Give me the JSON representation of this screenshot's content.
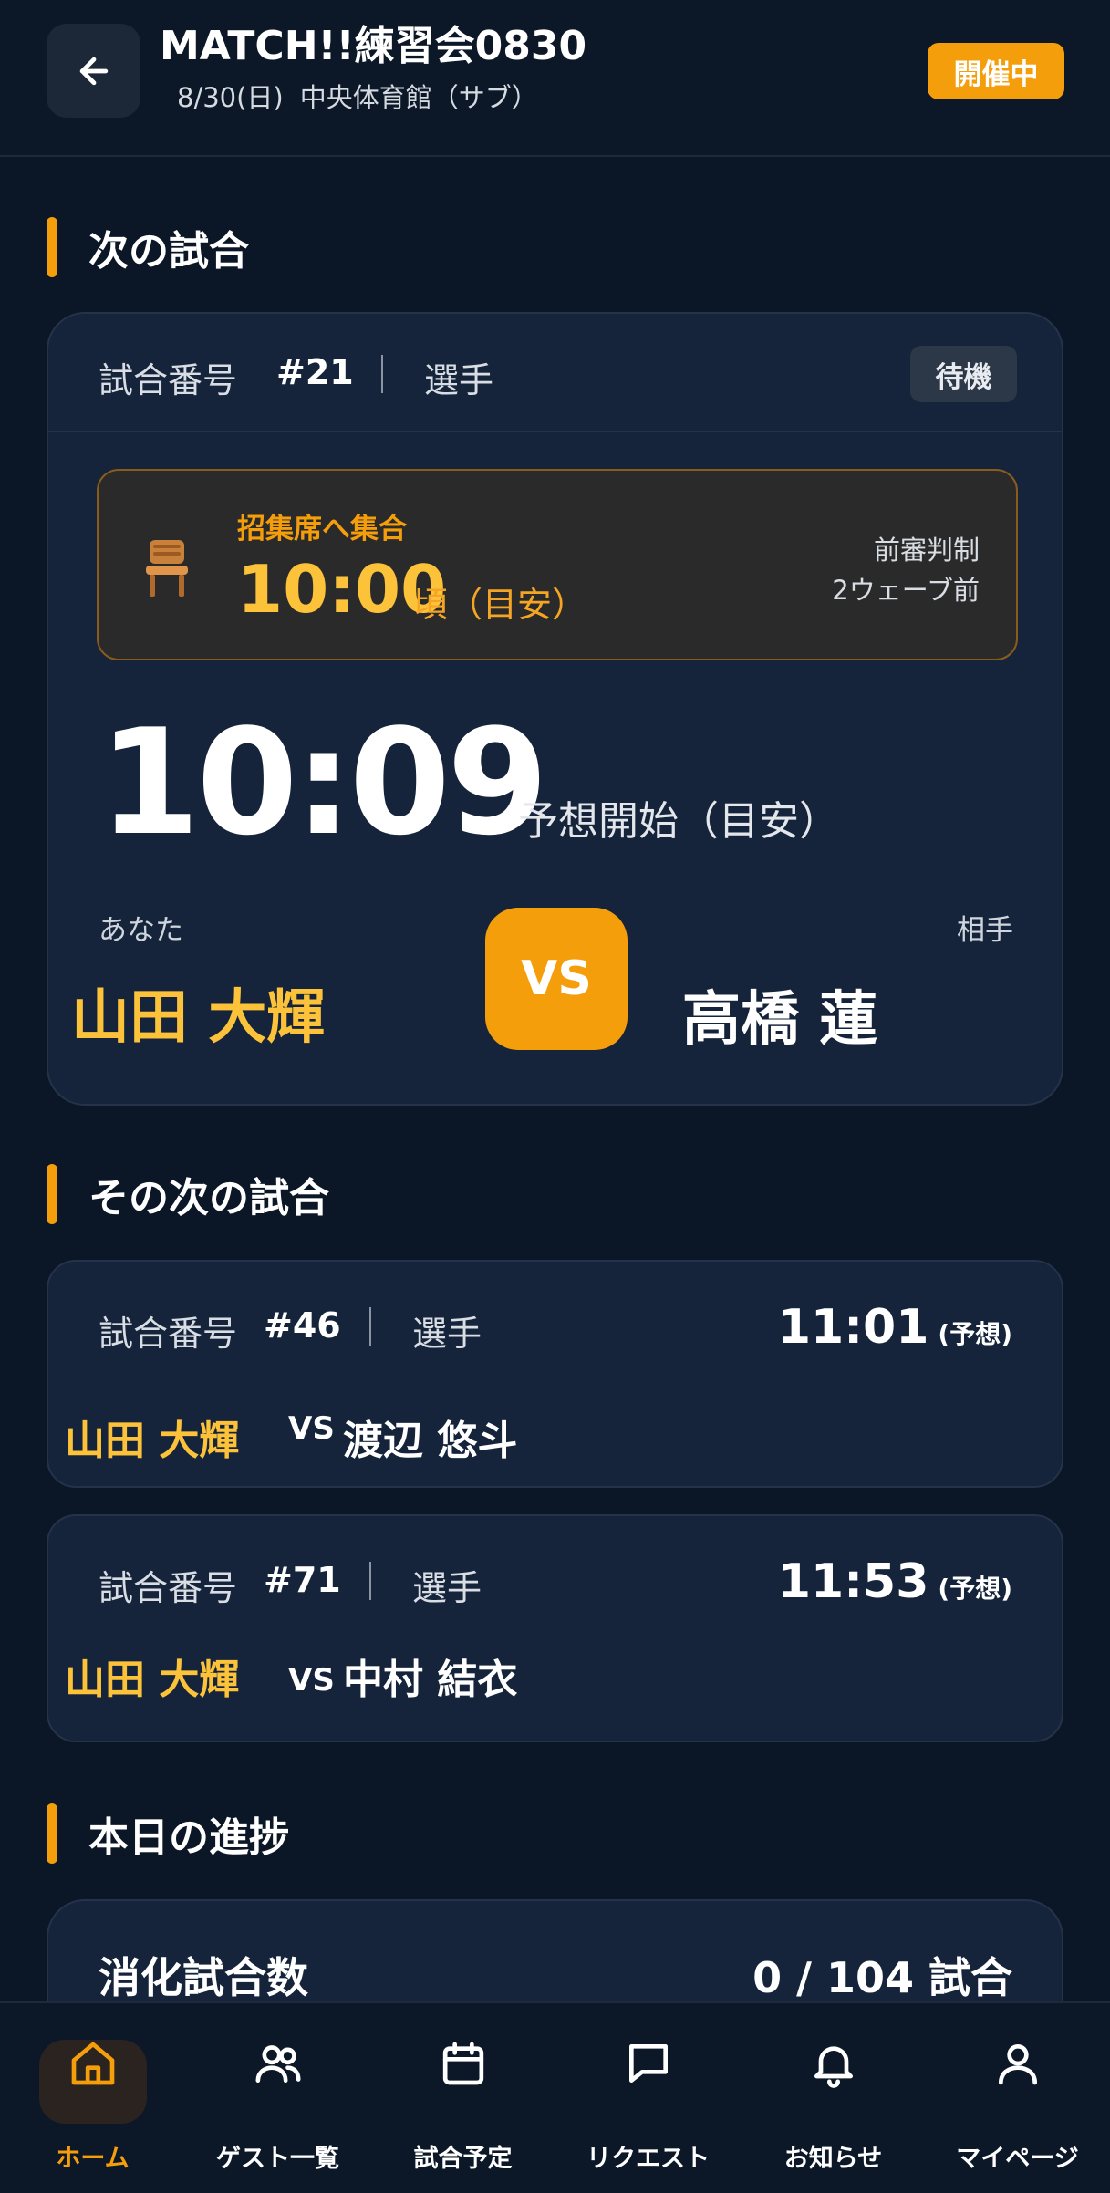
{
  "header": {
    "title": "MATCH!!練習会0830",
    "date": "8/30(日)",
    "venue": "中央体育館（サブ）",
    "status": "開催中"
  },
  "next_match": {
    "section_title": "次の試合",
    "match_label": "試合番号",
    "match_number": "#21",
    "role": "選手",
    "state": "待機",
    "call_label": "招集席へ集合",
    "call_time": "10:00",
    "call_suffix": "頃（目安）",
    "referee_note": "前審判制",
    "wave_note": "2ウェーブ前",
    "start_time": "10:09",
    "start_label": "予想開始（目安）",
    "you_label": "あなた",
    "opponent_label": "相手",
    "you_name": "山田 大輝",
    "opponent_name": "高橋 蓮",
    "vs": "VS"
  },
  "following": {
    "section_title": "その次の試合",
    "matches": [
      {
        "label": "試合番号",
        "number": "#46",
        "role": "選手",
        "time": "11:01",
        "time_note": "(予想)",
        "you": "山田 大輝",
        "vs": "VS",
        "opponent": "渡辺 悠斗"
      },
      {
        "label": "試合番号",
        "number": "#71",
        "role": "選手",
        "time": "11:53",
        "time_note": "(予想)",
        "you": "山田 大輝",
        "vs": "VS",
        "opponent": "中村 結衣"
      }
    ]
  },
  "progress": {
    "section_title": "本日の進捗",
    "label": "消化試合数",
    "value": "0 / 104 試合",
    "completed": 0,
    "total": 104
  },
  "tabs": [
    {
      "label": "ホーム",
      "icon": "home-icon",
      "active": true
    },
    {
      "label": "ゲスト一覧",
      "icon": "users-icon",
      "active": false
    },
    {
      "label": "試合予定",
      "icon": "calendar-icon",
      "active": false
    },
    {
      "label": "リクエスト",
      "icon": "chat-icon",
      "active": false
    },
    {
      "label": "お知らせ",
      "icon": "bell-icon",
      "active": false
    },
    {
      "label": "マイページ",
      "icon": "user-icon",
      "active": false
    }
  ],
  "colors": {
    "accent": "#f59e0b",
    "highlight_name": "#fcc33a",
    "background": "#0b1626",
    "card": "#15243a"
  }
}
